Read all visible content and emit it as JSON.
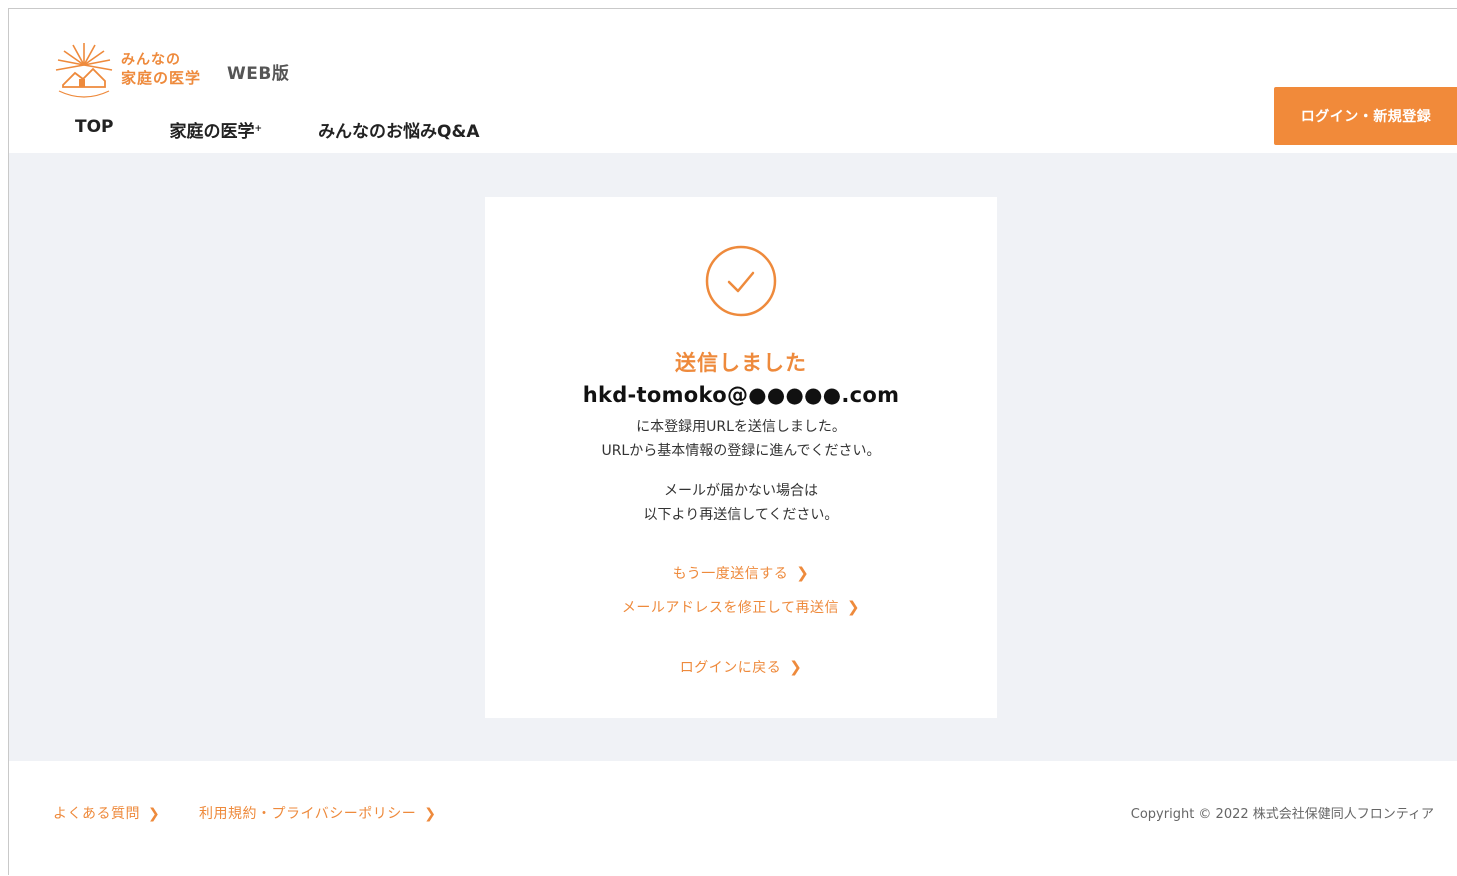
{
  "header": {
    "logo_line1": "みんなの",
    "logo_line2": "家庭の医学",
    "web_label": "WEB版",
    "nav": [
      "TOP",
      "家庭の医学",
      "みんなのお悩みQ&A"
    ],
    "nav_plus": "+",
    "login_button": "ログイン・新規登録"
  },
  "card": {
    "icon": "check-circle-icon",
    "title": "送信しました",
    "email": "hkd-tomoko@●●●●●.com",
    "message1_line1": "に本登録用URLを送信しました。",
    "message1_line2": "URLから基本情報の登録に進んでください。",
    "message2_line1": "メールが届かない場合は",
    "message2_line2": "以下より再送信してください。",
    "resend_link": "もう一度送信する",
    "edit_email_link": "メールアドレスを修正して再送信",
    "back_login_link": "ログインに戻る",
    "chevron": "❯"
  },
  "footer": {
    "faq_link": "よくある質問",
    "terms_link": "利用規約・プライバシーポリシー",
    "copyright": "Copyright © 2022 株式会社保健同人フロンティア"
  },
  "colors": {
    "accent": "#ee8a3c",
    "button": "#f18a3a",
    "background": "#f0f2f6"
  }
}
